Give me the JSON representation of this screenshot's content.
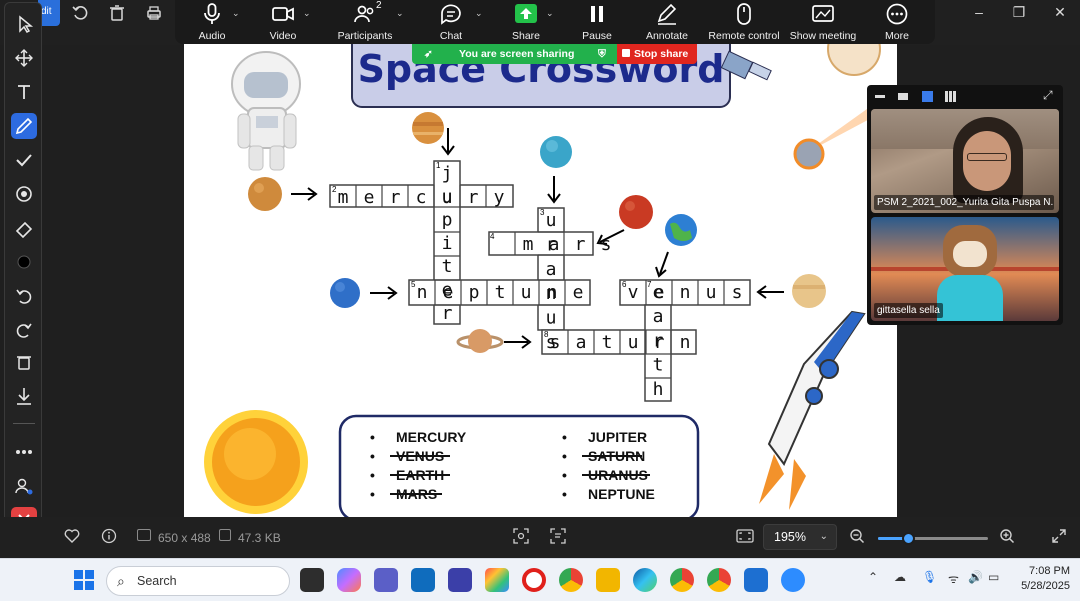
{
  "viewer": {
    "edit_tab": "dit",
    "window_controls": [
      "–",
      "❐",
      "✕"
    ],
    "image_size": "650 x 488",
    "file_size": "47.3 KB",
    "zoom_level": "195%",
    "zoom_slider_fraction": 0.27
  },
  "zoom_toolbar": {
    "participants_count": "2",
    "items": [
      {
        "label": "Audio",
        "icon": "mic-icon"
      },
      {
        "label": "Video",
        "icon": "camera-icon"
      },
      {
        "label": "Participants",
        "icon": "participants-icon"
      },
      {
        "label": "Chat",
        "icon": "chat-icon"
      },
      {
        "label": "Share",
        "icon": "share-icon"
      },
      {
        "label": "Pause",
        "icon": "pause-icon"
      },
      {
        "label": "Annotate",
        "icon": "pen-icon"
      },
      {
        "label": "Remote control",
        "icon": "mouse-icon"
      },
      {
        "label": "Show meeting",
        "icon": "screen-icon"
      },
      {
        "label": "More",
        "icon": "more-icon"
      }
    ]
  },
  "sharing": {
    "banner_text": "You are screen sharing",
    "stop_label": "Stop share"
  },
  "crossword": {
    "title": "Space Crossword",
    "number_labels": [
      "1",
      "2",
      "3",
      "4",
      "5",
      "6",
      "7",
      "8"
    ],
    "across": [
      {
        "number": "2",
        "answer": "mercury"
      },
      {
        "number": "4",
        "answer": "mars"
      },
      {
        "number": "5",
        "answer": "neptune"
      },
      {
        "number": "6",
        "answer": "venus"
      },
      {
        "number": "8",
        "answer": "saturn"
      }
    ],
    "down": [
      {
        "number": "1",
        "answer": "jupiter"
      },
      {
        "number": "3",
        "answer": "uranus"
      },
      {
        "number": "7",
        "answer": "earth"
      }
    ],
    "word_bank_left": [
      {
        "word": "MERCURY",
        "struck": false
      },
      {
        "word": "VENUS",
        "struck": true
      },
      {
        "word": "EARTH",
        "struck": true
      },
      {
        "word": "MARS",
        "struck": true
      }
    ],
    "word_bank_right": [
      {
        "word": "JUPITER",
        "struck": false
      },
      {
        "word": "SATURN",
        "struck": true
      },
      {
        "word": "URANUS",
        "struck": true
      },
      {
        "word": "NEPTUNE",
        "struck": false
      }
    ]
  },
  "video_panel": {
    "participants": [
      {
        "name": "PSM 2_2021_002_Yurita Gita Puspa N..."
      },
      {
        "name": "gittasella sella"
      }
    ]
  },
  "taskbar": {
    "search_label": "Search",
    "time": "7:08 PM",
    "date": "5/28/2025"
  },
  "colors": {
    "accent": "#2d6be0",
    "share_green": "#22b14c",
    "stop_red": "#e0261f",
    "title_box": "#c9cde8"
  }
}
